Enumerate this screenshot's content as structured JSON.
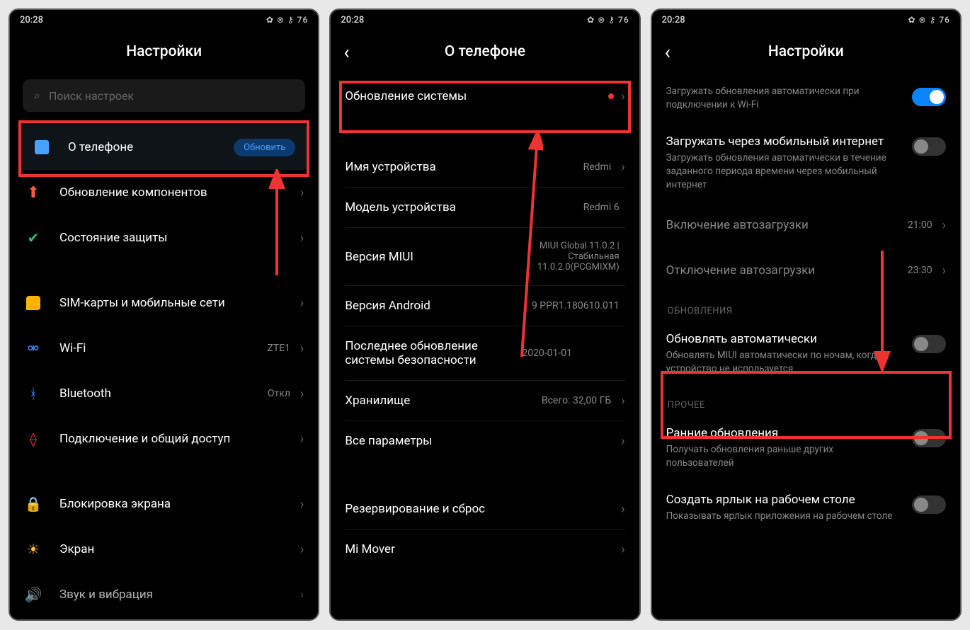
{
  "status": {
    "time": "20:28",
    "icons": "✿ ⊗ ⚷ 76"
  },
  "screen1": {
    "title": "Настройки",
    "search_placeholder": "Поиск настроек",
    "items": [
      {
        "label": "О телефоне",
        "badge": "Обновить",
        "icon": "phone",
        "color": "#4aa0ff"
      },
      {
        "label": "Обновление компонентов",
        "icon": "arrow-up",
        "color": "#ff5a3c"
      },
      {
        "label": "Состояние защиты",
        "icon": "shield",
        "color": "#2ec46b"
      },
      {
        "label": "SIM-карты и мобильные сети",
        "icon": "sim",
        "color": "#ffb300"
      },
      {
        "label": "Wi-Fi",
        "value": "ZTE1",
        "icon": "wifi",
        "color": "#3a8dff"
      },
      {
        "label": "Bluetooth",
        "value": "Откл",
        "icon": "bluetooth",
        "color": "#3a8dff"
      },
      {
        "label": "Подключение и общий доступ",
        "icon": "share",
        "color": "#e33b2f"
      },
      {
        "label": "Блокировка экрана",
        "icon": "lock",
        "color": "#e35b5b"
      },
      {
        "label": "Экран",
        "icon": "sun",
        "color": "#ffbb33"
      },
      {
        "label": "Звук и вибрация",
        "icon": "sound",
        "color": "#2ec46b"
      }
    ]
  },
  "screen2": {
    "title": "О телефоне",
    "items": [
      {
        "label": "Обновление системы",
        "dot": true
      },
      {
        "label": "Имя устройства",
        "value": "Redmi"
      },
      {
        "label": "Модель устройства",
        "value": "Redmi 6"
      },
      {
        "label": "Версия MIUI",
        "value": "MIUI Global 11.0.2 | Стабильная 11.0.2.0(PCGMIXM)"
      },
      {
        "label": "Версия Android",
        "value": "9 PPR1.180610.011"
      },
      {
        "label": "Последнее обновление системы безопасности",
        "value": "2020-01-01"
      },
      {
        "label": "Хранилище",
        "value": "Всего: 32,00 ГБ"
      },
      {
        "label": "Все параметры"
      },
      {
        "label": "Резервирование и сброс"
      },
      {
        "label": "Mi Mover"
      }
    ]
  },
  "screen3": {
    "title": "Настройки",
    "top_toggle": {
      "sub": "Загружать обновления автоматически при подключении к Wi-Fi",
      "on": true
    },
    "mobile_toggle": {
      "ttl": "Загружать через мобильный интернет",
      "sub": "Загружать обновления автоматически в течение заданного периода времени через мобильный интернет",
      "on": false
    },
    "time_rows": [
      {
        "label": "Включение автозагрузки",
        "value": "21:00"
      },
      {
        "label": "Отключение автозагрузки",
        "value": "23:30"
      }
    ],
    "section_updates": "ОБНОВЛЕНИЯ",
    "auto_update": {
      "ttl": "Обновлять автоматически",
      "sub": "Обновлять MIUI автоматически по ночам, когда устройство не используется",
      "on": false
    },
    "section_other": "ПРОЧЕЕ",
    "early": {
      "ttl": "Ранние обновления",
      "sub": "Получать обновления раньше других пользователей",
      "on": false
    },
    "shortcut": {
      "ttl": "Создать ярлык на рабочем столе",
      "sub": "Показывать ярлык приложения на рабочем столе",
      "on": false
    }
  }
}
